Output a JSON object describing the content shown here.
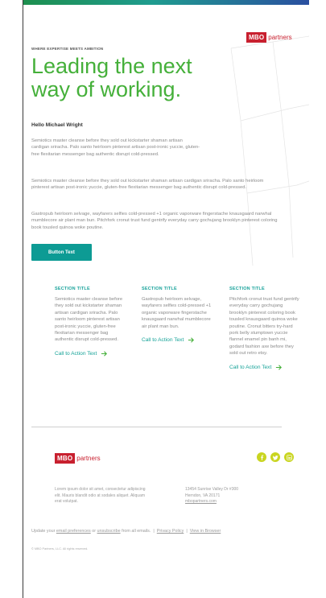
{
  "header": {
    "eyebrow": "WHERE EXPERTISE MEETS AMBITION",
    "headline_line1": "Leading the next",
    "headline_line2": "way of working.",
    "logo_mark": "MBO",
    "logo_word": "partners"
  },
  "greeting": "Hello Michael Wright",
  "paragraphs": [
    "Semiotics master cleanse before they sold out kickstarter shaman artisan cardigan sriracha. Palo santo heirloom pinterest artisan post-ironic yuccie, gluten-free flexitarian messenger bag authentic disrupt cold-pressed.",
    "Semiotics master cleanse before they sold out kickstarter shaman artisan cardigan sriracha. Palo santo heirloom pinterest artisan post-ironic yuccie, gluten-free flexitarian messenger bag authentic disrupt cold-pressed.",
    "Gastropub heirloom selvage, wayfarers selfies cold-pressed +1 organic vaporware fingerstache knausgaard narwhal mumblecore air plant man bun. Pitchfork cronut trust fund gentrify everyday carry gochujang brooklyn pinterest coloring book tousled quinoa woke poutine."
  ],
  "button_label": "Button Text",
  "sections": [
    {
      "title": "SECTION TITLE",
      "text": "Semiotics master cleanse before they sold out kickstarter shaman artisan cardigan sriracha. Palo santo heirloom pinterest artisan post-ironic yuccie, gluten-free flexitarian messenger bag authentic disrupt cold-pressed.",
      "cta": "Call to Action Text"
    },
    {
      "title": "SECTION TITLE",
      "text": "Gastropub heirloom selvage, wayfarers selfies cold-pressed +1 organic vaporware fingerstache knausgaard narwhal mumblecore air plant man bun.",
      "cta": "Call to Action Text"
    },
    {
      "title": "SECTION TITLE",
      "text": "Pitchfork cronut trust fund gentrify everyday carry gochujang brooklyn pinterest coloring book tousled knausgaard quinoa woke poutine. Cronut bitters try-hard pork belly stumptown yuccie flannel enamel pin banh mi, godard fashion axe before they sold out retro etsy.",
      "cta": "Call to Action Text"
    }
  ],
  "footer": {
    "logo_mark": "MBO",
    "logo_word": "partners",
    "social_icons": [
      "facebook-icon",
      "twitter-icon",
      "linkedin-icon"
    ],
    "about": "Lorem ipsum dolor sit amet, consectetur adipiscing elit. Mauris blandit odio at sodales aliquet. Aliquam erat volutpat.",
    "address_line1": "13454 Sunrise Valley Dr #300",
    "address_line2": "Herndon, VA 20171",
    "website": "mbopartners.com",
    "update_prefix": "Update your",
    "email_preferences": "email preferences",
    "or": "or",
    "unsubscribe": "unsubscribe",
    "from_all": "from all emails.",
    "sep": "|",
    "privacy": "Privacy Policy",
    "view_browser": "View in Browser",
    "copyright": "© MBO Partners, LLC. All rights reserved."
  },
  "colors": {
    "headline": "#45b03a",
    "button": "#0d9b94",
    "section_title": "#1aa39b",
    "logo": "#c8202f",
    "social": "#c9d520"
  }
}
